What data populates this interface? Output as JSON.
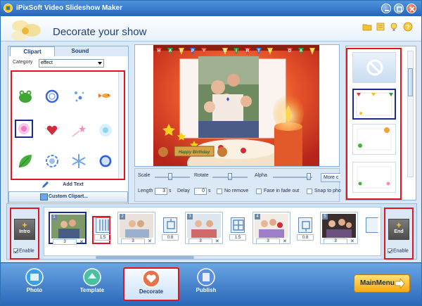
{
  "window": {
    "title": "iPixSoft Video Slideshow Maker",
    "header_title": "Decorate your show"
  },
  "header_icons": [
    "folder-icon",
    "favorite-icon",
    "lightbulb-icon",
    "help-icon"
  ],
  "clipart_panel": {
    "tabs": [
      {
        "label": "Clipart",
        "active": true
      },
      {
        "label": "Sound",
        "active": false
      }
    ],
    "category_label": "Category",
    "category_value": "effect",
    "cliparts": [
      "frog-clipart",
      "ring-clipart",
      "sparkle-clipart",
      "fish-clipart",
      "pink-glow-clipart",
      "winged-heart-clipart",
      "shooting-star-clipart",
      "blue-glow-clipart",
      "leaf-clipart",
      "blue-flower-clipart",
      "snowflake-clipart",
      "blue-ring-clipart"
    ],
    "add_text_label": "Add Text",
    "custom_clipart_label": "Custom Clipart..."
  },
  "preview": {
    "banner_letters": [
      "H",
      "A",
      "P",
      "P",
      "Y",
      "B",
      "I",
      "R",
      "T",
      "H",
      "D",
      "A",
      "Y"
    ],
    "sign_text": "Happy Birthday"
  },
  "controls": {
    "scale_label": "Scale",
    "rotate_label": "Rotate",
    "alpha_label": "Alpha",
    "more_label": "More c",
    "length_label": "Length",
    "length_value": "3",
    "length_unit": "s",
    "delay_label": "Delay",
    "delay_value": "0",
    "delay_unit": "s",
    "no_remove_label": "No remove",
    "fade_label": "Fase in fade out",
    "snap_label": "Snap to pho"
  },
  "decorations": {
    "frames": [
      "no-decoration",
      "flag-frame",
      "balloon-frame",
      "flower-frame"
    ],
    "selected_index": 1
  },
  "timeline": {
    "intro_label": "Intro",
    "end_label": "End",
    "enable_label": "Enable",
    "slides": [
      {
        "num": "1",
        "duration": "3"
      },
      {
        "num": "2",
        "duration": "3"
      },
      {
        "num": "3",
        "duration": "3"
      },
      {
        "num": "4",
        "duration": "3"
      },
      {
        "num": "5",
        "duration": "3"
      }
    ],
    "transitions": [
      {
        "duration": "1.5"
      },
      {
        "duration": "0.8"
      },
      {
        "duration": "1.5"
      },
      {
        "duration": "0.8"
      }
    ],
    "delete_glyph": "✕"
  },
  "nav": {
    "items": [
      {
        "label": "Photo",
        "active": false
      },
      {
        "label": "Template",
        "active": false
      },
      {
        "label": "Decorate",
        "active": true
      },
      {
        "label": "Publish",
        "active": false
      }
    ],
    "main_menu_label": "MainMenu"
  },
  "colors": {
    "highlight": "#e3141e",
    "selection": "#1a2c8c",
    "accent_blue": "#2a66b9",
    "main_menu": "#f6a80c"
  }
}
